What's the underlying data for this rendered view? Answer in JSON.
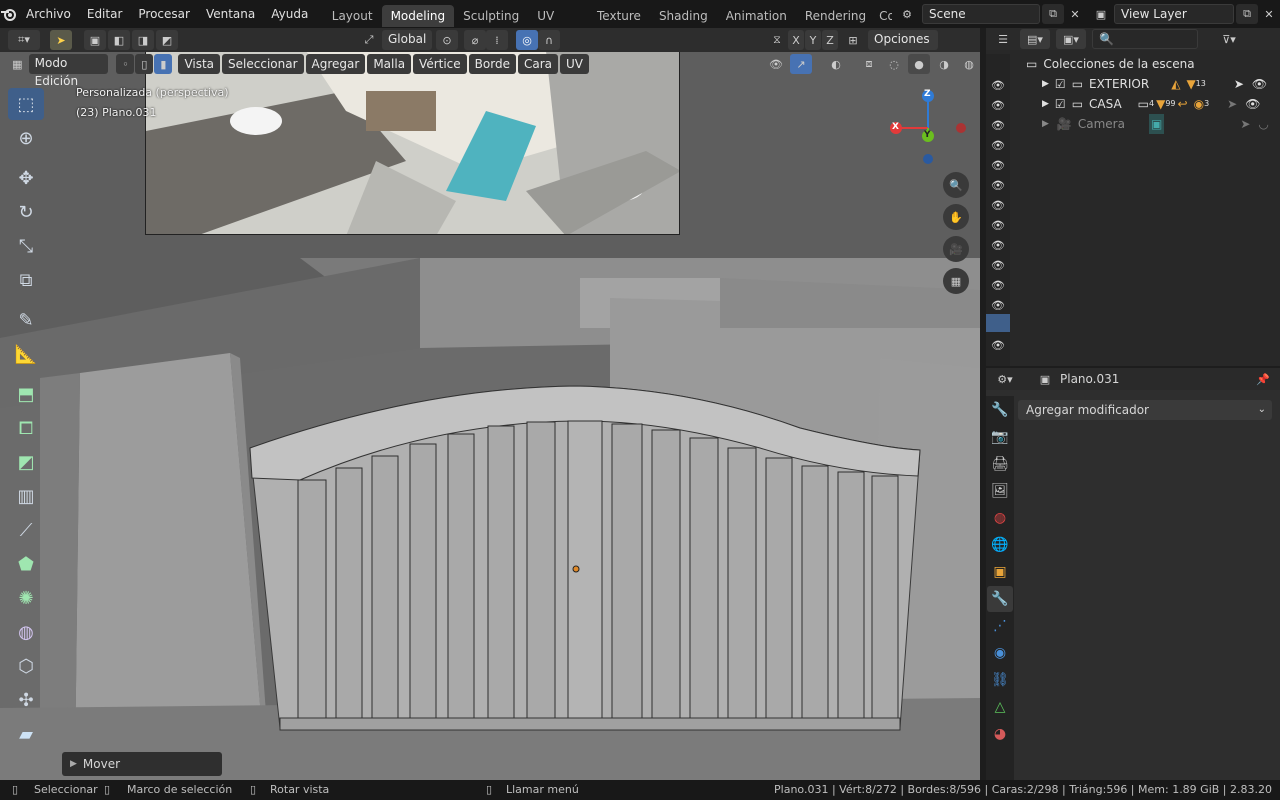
{
  "menu": [
    "Archivo",
    "Editar",
    "Procesar",
    "Ventana",
    "Ayuda"
  ],
  "workspaces": [
    {
      "label": "Layout",
      "active": false
    },
    {
      "label": "Modeling",
      "active": true
    },
    {
      "label": "Sculpting",
      "active": false
    },
    {
      "label": "UV Editing",
      "active": false
    },
    {
      "label": "Texture Paint",
      "active": false
    },
    {
      "label": "Shading",
      "active": false
    },
    {
      "label": "Animation",
      "active": false
    },
    {
      "label": "Rendering",
      "active": false
    },
    {
      "label": "Com",
      "active": false
    }
  ],
  "scene": {
    "name": "Scene",
    "view_layer": "View Layer"
  },
  "viewport_header": {
    "transform_orientation": "Global",
    "axes": [
      "X",
      "Y",
      "Z"
    ],
    "options": "Opciones",
    "mode": "Modo Edición",
    "menus": [
      "Vista",
      "Seleccionar",
      "Agregar",
      "Malla",
      "Vértice",
      "Borde",
      "Cara",
      "UV"
    ]
  },
  "viewport_info": {
    "view_name": "Personalizada (perspectiva)",
    "object_name": "(23) Plano.031"
  },
  "gizmo": {
    "x": "X",
    "y": "Y",
    "z": "Z"
  },
  "last_operator": "Mover",
  "outliner": {
    "search_placeholder": "",
    "root": "Colecciones de la escena",
    "items": [
      {
        "name": "EXTERIOR",
        "badge": "13"
      },
      {
        "name": "CASA",
        "badge": "3",
        "badge2": "4",
        "badge3": "99"
      },
      {
        "name": "Camera",
        "badge": ""
      }
    ]
  },
  "properties": {
    "object_name": "Plano.031",
    "add_modifier": "Agregar modificador"
  },
  "statusbar": {
    "select": "Seleccionar",
    "box_select": "Marco de selección",
    "rotate_view": "Rotar vista",
    "call_menu": "Llamar menú",
    "stats": "Plano.031 | Vért:8/272 | Bordes:8/596 | Caras:2/298 | Triáng:596 | Mem: 1.89 GiB | 2.83.20"
  },
  "colors": {
    "accent": "#4772b3",
    "viewport_bg": "#6b6b6b",
    "x_axis": "#e23a3a",
    "y_axis": "#6bbe1f",
    "z_axis": "#2f7bd6"
  }
}
